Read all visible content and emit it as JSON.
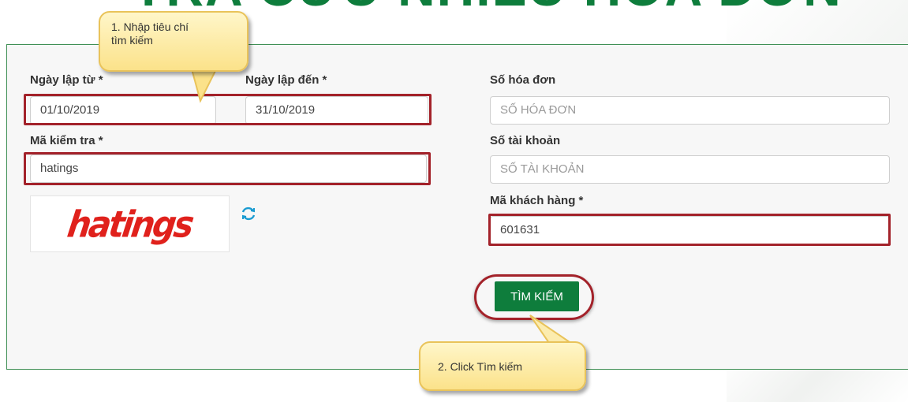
{
  "page": {
    "title": "TRA CỨU NHIỀU HÓA ĐƠN"
  },
  "form": {
    "date_from": {
      "label": "Ngày lập từ *",
      "value": "01/10/2019"
    },
    "date_to": {
      "label": "Ngày lập đến *",
      "value": "31/10/2019"
    },
    "captcha_field": {
      "label": "Mã kiểm tra *",
      "value": "hatings"
    },
    "captcha_image": {
      "text": "hatings"
    },
    "invoice_number": {
      "label": "Số hóa đơn",
      "placeholder": "SỐ HÓA ĐƠN"
    },
    "account_number": {
      "label": "Số tài khoản",
      "placeholder": "SỐ TÀI KHOẢN"
    },
    "customer_code": {
      "label": "Mã khách hàng *",
      "value": "601631"
    },
    "search_button": {
      "label": "TÌM KIẾM"
    }
  },
  "callouts": {
    "step1_line1": "1. Nhập tiêu chí",
    "step1_line2": "tìm kiếm",
    "step2": "2. Click Tìm kiếm"
  },
  "icons": {
    "refresh": "refresh-icon"
  },
  "colors": {
    "brand_green": "#0e7d3c",
    "highlight_red": "#a3222a",
    "captcha_red": "#e0211c",
    "callout_yellow": "#fbe28a"
  }
}
